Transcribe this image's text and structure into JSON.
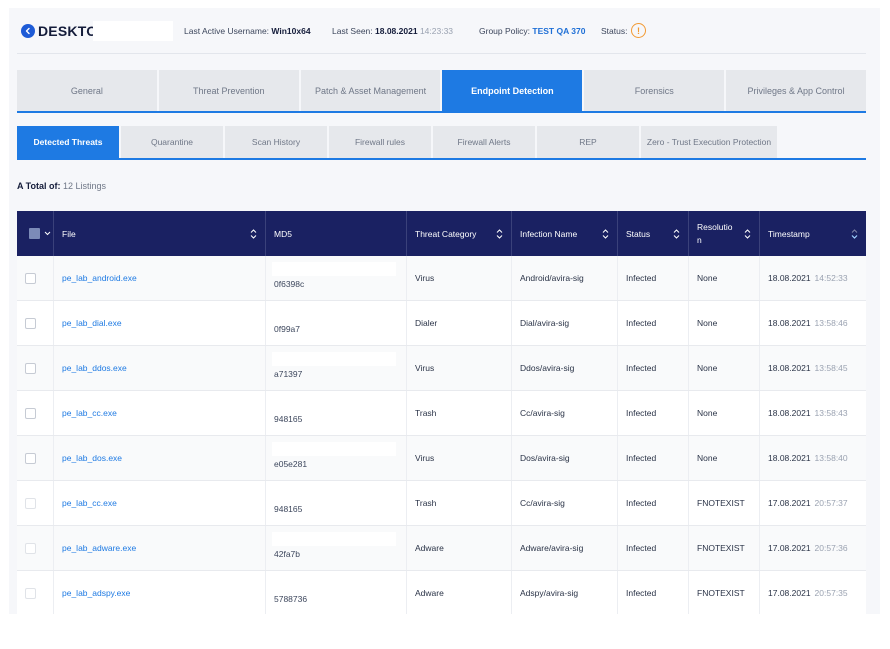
{
  "header": {
    "hostname": "DESKTOP",
    "last_active_label": "Last Active Username:",
    "last_active_value": "Win10x64",
    "last_seen_label": "Last Seen:",
    "last_seen_date": "18.08.2021",
    "last_seen_time": "14:23:33",
    "group_policy_label": "Group Policy:",
    "group_policy_value": "TEST QA 370",
    "status_label": "Status:",
    "status_icon": "!"
  },
  "main_tabs": [
    {
      "label": "General"
    },
    {
      "label": "Threat Prevention"
    },
    {
      "label": "Patch & Asset Management"
    },
    {
      "label": "Endpoint Detection"
    },
    {
      "label": "Forensics"
    },
    {
      "label": "Privileges & App Control"
    }
  ],
  "sub_tabs": [
    {
      "label": "Detected Threats"
    },
    {
      "label": "Quarantine"
    },
    {
      "label": "Scan History"
    },
    {
      "label": "Firewall rules"
    },
    {
      "label": "Firewall Alerts"
    },
    {
      "label": "REP"
    },
    {
      "label": "Zero - Trust Execution Protection"
    }
  ],
  "total": {
    "label": "A Total of:",
    "value": "12 Listings"
  },
  "table": {
    "columns": [
      "File",
      "MD5",
      "Threat Category",
      "Infection Name",
      "Status",
      "Resolution",
      "Timestamp"
    ],
    "rows": [
      {
        "file": "pe_lab_android.exe",
        "md5": "0f6398c",
        "category": "Virus",
        "infection": "Android/avira-sig",
        "status": "Infected",
        "resolution": "None",
        "date": "18.08.2021",
        "time": "14:52:33"
      },
      {
        "file": "pe_lab_dial.exe",
        "md5": "0f99a7",
        "category": "Dialer",
        "infection": "Dial/avira-sig",
        "status": "Infected",
        "resolution": "None",
        "date": "18.08.2021",
        "time": "13:58:46"
      },
      {
        "file": "pe_lab_ddos.exe",
        "md5": "a71397",
        "category": "Virus",
        "infection": "Ddos/avira-sig",
        "status": "Infected",
        "resolution": "None",
        "date": "18.08.2021",
        "time": "13:58:45"
      },
      {
        "file": "pe_lab_cc.exe",
        "md5": "948165",
        "category": "Trash",
        "infection": "Cc/avira-sig",
        "status": "Infected",
        "resolution": "None",
        "date": "18.08.2021",
        "time": "13:58:43"
      },
      {
        "file": "pe_lab_dos.exe",
        "md5": "e05e281",
        "category": "Virus",
        "infection": "Dos/avira-sig",
        "status": "Infected",
        "resolution": "None",
        "date": "18.08.2021",
        "time": "13:58:40"
      },
      {
        "file": "pe_lab_cc.exe",
        "md5": "948165",
        "category": "Trash",
        "infection": "Cc/avira-sig",
        "status": "Infected",
        "resolution": "FNOTEXIST",
        "date": "17.08.2021",
        "time": "20:57:37"
      },
      {
        "file": "pe_lab_adware.exe",
        "md5": "42fa7b",
        "category": "Adware",
        "infection": "Adware/avira-sig",
        "status": "Infected",
        "resolution": "FNOTEXIST",
        "date": "17.08.2021",
        "time": "20:57:36"
      },
      {
        "file": "pe_lab_adspy.exe",
        "md5": "5788736",
        "category": "Adware",
        "infection": "Adspy/avira-sig",
        "status": "Infected",
        "resolution": "FNOTEXIST",
        "date": "17.08.2021",
        "time": "20:57:35"
      }
    ]
  },
  "colors": {
    "accent": "#1e7ae3",
    "table_header": "#1a2162",
    "link": "#1e7ae3",
    "status_warning": "#f29a33"
  }
}
